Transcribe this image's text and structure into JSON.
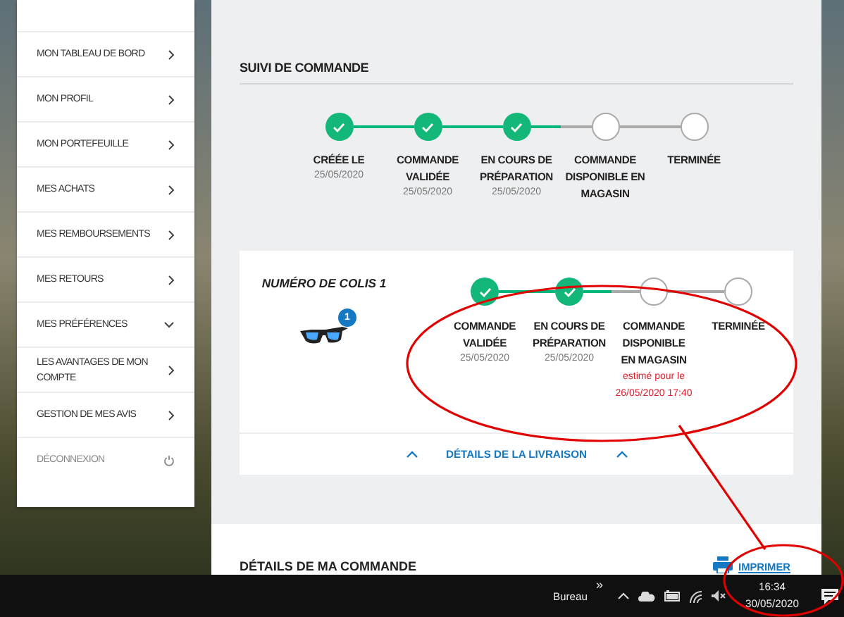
{
  "sidebar": {
    "items": [
      {
        "label": "MON TABLEAU DE BORD",
        "kind": "link"
      },
      {
        "label": "MON PROFIL",
        "kind": "link"
      },
      {
        "label": "MON PORTEFEUILLE",
        "kind": "link"
      },
      {
        "label": "MES ACHATS",
        "kind": "link"
      },
      {
        "label": "MES REMBOURSEMENTS",
        "kind": "link"
      },
      {
        "label": "MES RETOURS",
        "kind": "link"
      },
      {
        "label": "MES PRÉFÉRENCES",
        "kind": "dropdown"
      },
      {
        "label": "LES AVANTAGES DE MON COMPTE",
        "kind": "link"
      },
      {
        "label": "GESTION DE MES AVIS",
        "kind": "link"
      },
      {
        "label": "DÉCONNEXION",
        "kind": "logout"
      }
    ]
  },
  "order_tracking": {
    "title": "SUIVI DE COMMANDE",
    "steps": [
      {
        "label": "CRÉÉE LE",
        "date": "25/05/2020",
        "done": true
      },
      {
        "label": "COMMANDE VALIDÉE",
        "date": "25/05/2020",
        "done": true
      },
      {
        "label": "EN COURS DE PRÉPARATION",
        "date": "25/05/2020",
        "done": true
      },
      {
        "label": "COMMANDE DISPONIBLE EN MAGASIN",
        "done": false
      },
      {
        "label": "TERMINÉE",
        "done": false
      }
    ]
  },
  "package": {
    "title": "NUMÉRO DE COLIS 1",
    "item_count": "1",
    "steps": [
      {
        "label": "COMMANDE VALIDÉE",
        "date": "25/05/2020",
        "done": true
      },
      {
        "label": "EN COURS DE PRÉPARATION",
        "date": "25/05/2020",
        "done": true
      },
      {
        "label": "COMMANDE DISPONIBLE EN MAGASIN",
        "estimate": "estimé pour le 26/05/2020 17:40",
        "done": false
      },
      {
        "label": "TERMINÉE",
        "done": false
      }
    ],
    "details_link": "DÉTAILS DE LA LIVRAISON"
  },
  "order_details": {
    "title": "DÉTAILS DE MA COMMANDE",
    "print_link": "IMPRIMER"
  },
  "taskbar": {
    "toolbar_label": "Bureau",
    "overflow": "»",
    "time": "16:34",
    "date": "30/05/2020"
  }
}
